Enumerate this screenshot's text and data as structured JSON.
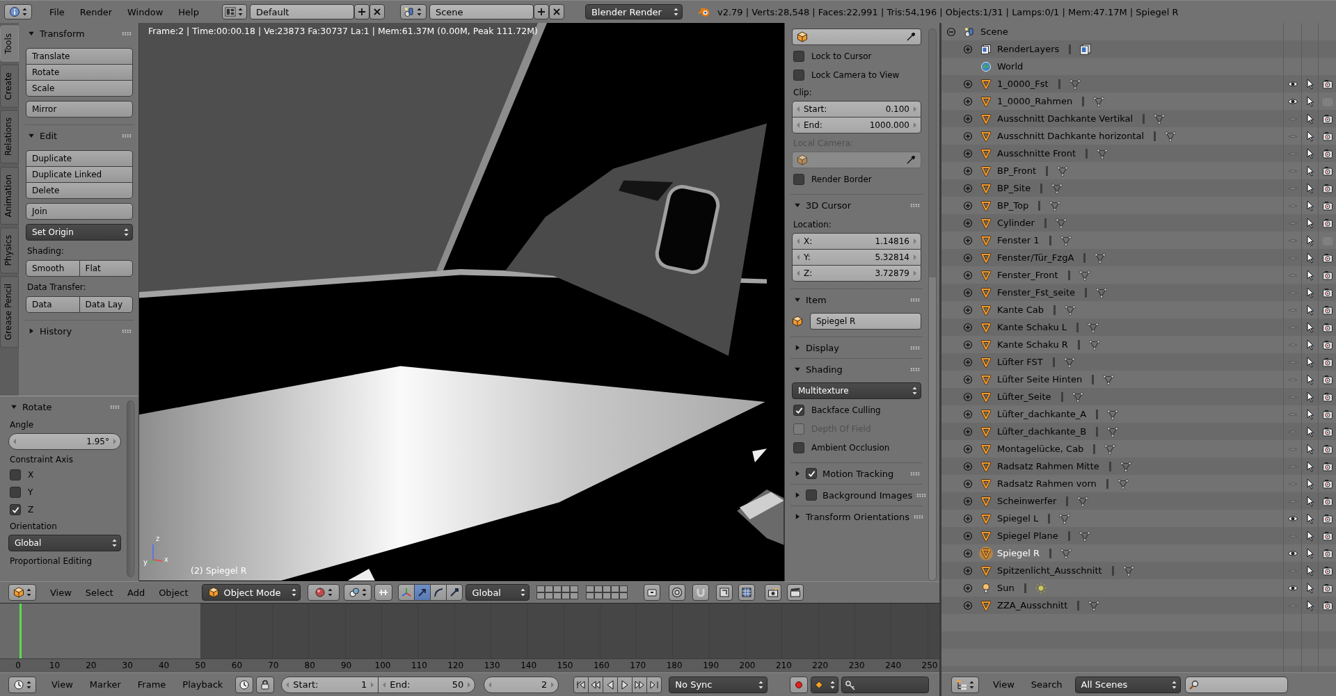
{
  "top_bar": {
    "menus": [
      "File",
      "Render",
      "Window",
      "Help"
    ],
    "screen_layout": "Default",
    "scene": "Scene",
    "render_engine": "Blender Render",
    "stats": "v2.79 | Verts:28,548 | Faces:22,991 | Tris:54,196 | Objects:1/31 | Lamps:0/1 | Mem:47.17M | Spiegel R"
  },
  "tool_shelf": {
    "tabs": [
      {
        "label": "Tools",
        "selected": true
      },
      {
        "label": "Create",
        "selected": false
      },
      {
        "label": "Relations",
        "selected": false
      },
      {
        "label": "Animation",
        "selected": false
      },
      {
        "label": "Physics",
        "selected": false
      },
      {
        "label": "Grease Pencil",
        "selected": false
      }
    ],
    "panels": [
      {
        "title": "Transform",
        "expanded": true,
        "items": [
          {
            "kind": "column",
            "buttons": [
              "Translate",
              "Rotate",
              "Scale"
            ]
          },
          {
            "kind": "column",
            "buttons": [
              "Mirror"
            ]
          }
        ]
      },
      {
        "title": "Edit",
        "expanded": true,
        "items": [
          {
            "kind": "column",
            "buttons": [
              "Duplicate",
              "Duplicate Linked",
              "Delete"
            ]
          },
          {
            "kind": "column",
            "buttons": [
              "Join"
            ]
          },
          {
            "kind": "dropdown",
            "value": "Set Origin"
          },
          {
            "kind": "label",
            "text": "Shading:"
          },
          {
            "kind": "row",
            "buttons": [
              "Smooth",
              "Flat"
            ]
          },
          {
            "kind": "label",
            "text": "Data Transfer:"
          },
          {
            "kind": "row",
            "buttons": [
              "Data",
              "Data Lay"
            ]
          }
        ]
      },
      {
        "title": "History",
        "expanded": false
      }
    ]
  },
  "operator_panel": {
    "title": "Rotate",
    "expanded": true,
    "items": [
      {
        "kind": "label",
        "text": "Angle"
      },
      {
        "kind": "number",
        "value": "1.95°"
      },
      {
        "kind": "label",
        "text": "Constraint Axis"
      },
      {
        "kind": "checkbox",
        "label": "X",
        "checked": false
      },
      {
        "kind": "checkbox",
        "label": "Y",
        "checked": false
      },
      {
        "kind": "checkbox",
        "label": "Z",
        "checked": true
      },
      {
        "kind": "label",
        "text": "Orientation"
      },
      {
        "kind": "dropdown",
        "value": "Global"
      },
      {
        "kind": "label",
        "text": "Proportional Editing"
      }
    ]
  },
  "viewport": {
    "info": "Frame:2 | Time:00:00.18 | Ve:23873 Fa:30737 La:1 | Mem:61.37M (0.00M, Peak 111.72M)",
    "object_label": "(2) Spiegel R",
    "axes": [
      "z",
      "y",
      "x"
    ]
  },
  "properties": {
    "panels": [
      {
        "items": [
          {
            "kind": "object_field",
            "disabled": false
          },
          {
            "kind": "checkbox",
            "label": "Lock to Cursor",
            "checked": false,
            "disabled": false
          },
          {
            "kind": "checkbox",
            "label": "Lock Camera to View",
            "checked": false,
            "disabled": false
          },
          {
            "kind": "label",
            "text": "Clip:",
            "disabled": false
          },
          {
            "kind": "number_group",
            "fields": [
              {
                "label": "Start:",
                "value": "0.100"
              },
              {
                "label": "End:",
                "value": "1000.000"
              }
            ]
          },
          {
            "kind": "label",
            "text": "Local Camera:",
            "disabled": true
          },
          {
            "kind": "object_field",
            "disabled": true
          },
          {
            "kind": "checkbox",
            "label": "Render Border",
            "checked": false,
            "disabled": false
          }
        ]
      },
      {
        "title": "3D Cursor",
        "expanded": true,
        "items": [
          {
            "kind": "label",
            "text": "Location:",
            "disabled": false
          },
          {
            "kind": "number_group",
            "fields": [
              {
                "label": "X:",
                "value": "1.14816"
              },
              {
                "label": "Y:",
                "value": "5.32814"
              },
              {
                "label": "Z:",
                "value": "3.72879"
              }
            ]
          }
        ]
      },
      {
        "title": "Item",
        "expanded": true,
        "items": [
          {
            "kind": "name_field",
            "value": "Spiegel R"
          }
        ]
      },
      {
        "title": "Display",
        "expanded": false
      },
      {
        "title": "Shading",
        "expanded": true,
        "items": [
          {
            "kind": "dropdown",
            "value": "Multitexture"
          },
          {
            "kind": "checkbox",
            "label": "Backface Culling",
            "checked": true,
            "disabled": false
          },
          {
            "kind": "checkbox",
            "label": "Depth Of Field",
            "checked": false,
            "disabled": true
          },
          {
            "kind": "checkbox",
            "label": "Ambient Occlusion",
            "checked": false,
            "disabled": false
          }
        ]
      },
      {
        "title": "Motion Tracking",
        "expanded": false,
        "enabled": true
      },
      {
        "title": "Background Images",
        "expanded": false,
        "enabled": false
      },
      {
        "title": "Transform Orientations",
        "expanded": false
      }
    ]
  },
  "outliner": {
    "tree": [
      {
        "name": "Scene",
        "kind": "scene",
        "expanded": true,
        "children": [
          {
            "name": "RenderLayers",
            "kind": "renderlayers",
            "expanded": false
          },
          {
            "name": "World",
            "kind": "world"
          },
          {
            "name": "1_0000_Fst",
            "kind": "mesh",
            "expanded": false,
            "visible": true,
            "renderable": true,
            "selected": false
          },
          {
            "name": "1_0000_Rahmen",
            "kind": "mesh",
            "expanded": false,
            "visible": true,
            "renderable": false,
            "selected": false
          },
          {
            "name": "Ausschnitt Dachkante Vertikal",
            "kind": "mesh",
            "expanded": false,
            "visible": false,
            "renderable": true,
            "selected": false
          },
          {
            "name": "Ausschnitt Dachkante horizontal",
            "kind": "mesh",
            "expanded": false,
            "visible": false,
            "renderable": true,
            "selected": false
          },
          {
            "name": "Ausschnitte Front",
            "kind": "mesh",
            "expanded": false,
            "visible": false,
            "renderable": true,
            "selected": false
          },
          {
            "name": "BP_Front",
            "kind": "mesh",
            "expanded": false,
            "visible": false,
            "renderable": true,
            "selected": false
          },
          {
            "name": "BP_Site",
            "kind": "mesh",
            "expanded": false,
            "visible": false,
            "renderable": true,
            "selected": false
          },
          {
            "name": "BP_Top",
            "kind": "mesh",
            "expanded": false,
            "visible": false,
            "renderable": true,
            "selected": false
          },
          {
            "name": "Cylinder",
            "kind": "mesh",
            "expanded": false,
            "visible": false,
            "renderable": true,
            "selected": false
          },
          {
            "name": "Fenster 1",
            "kind": "mesh",
            "expanded": false,
            "visible": false,
            "renderable": false,
            "selected": false
          },
          {
            "name": "Fenster/Tür_FzgA",
            "kind": "mesh",
            "expanded": false,
            "visible": false,
            "renderable": true,
            "selected": false
          },
          {
            "name": "Fenster_Front",
            "kind": "mesh",
            "expanded": false,
            "visible": false,
            "renderable": true,
            "selected": false
          },
          {
            "name": "Fenster_Fst_seite",
            "kind": "mesh",
            "expanded": false,
            "visible": false,
            "renderable": true,
            "selected": false
          },
          {
            "name": "Kante Cab",
            "kind": "mesh",
            "expanded": false,
            "visible": false,
            "renderable": true,
            "selected": false
          },
          {
            "name": "Kante Schaku L",
            "kind": "mesh",
            "expanded": false,
            "visible": false,
            "renderable": true,
            "selected": false
          },
          {
            "name": "Kante Schaku R",
            "kind": "mesh",
            "expanded": false,
            "visible": false,
            "renderable": true,
            "selected": false
          },
          {
            "name": "Lüfter FST",
            "kind": "mesh",
            "expanded": false,
            "visible": false,
            "renderable": true,
            "selected": false
          },
          {
            "name": "Lüfter Seite Hinten",
            "kind": "mesh",
            "expanded": false,
            "visible": false,
            "renderable": true,
            "selected": false
          },
          {
            "name": "Lüfter_Seite",
            "kind": "mesh",
            "expanded": false,
            "visible": false,
            "renderable": true,
            "selected": false
          },
          {
            "name": "Lüfter_dachkante_A",
            "kind": "mesh",
            "expanded": false,
            "visible": false,
            "renderable": true,
            "selected": false
          },
          {
            "name": "Lüfter_dachkante_B",
            "kind": "mesh",
            "expanded": false,
            "visible": false,
            "renderable": true,
            "selected": false
          },
          {
            "name": "Montagelücke, Cab",
            "kind": "mesh",
            "expanded": false,
            "visible": false,
            "renderable": true,
            "selected": false
          },
          {
            "name": "Radsatz Rahmen Mitte",
            "kind": "mesh",
            "expanded": false,
            "visible": false,
            "renderable": true,
            "selected": false
          },
          {
            "name": "Radsatz Rahmen vorn",
            "kind": "mesh",
            "expanded": false,
            "visible": false,
            "renderable": true,
            "selected": false
          },
          {
            "name": "Scheinwerfer",
            "kind": "mesh",
            "expanded": false,
            "visible": false,
            "renderable": true,
            "selected": false
          },
          {
            "name": "Spiegel L",
            "kind": "mesh",
            "expanded": false,
            "visible": true,
            "renderable": true,
            "selected": false
          },
          {
            "name": "Spiegel Plane",
            "kind": "mesh",
            "expanded": false,
            "visible": false,
            "renderable": true,
            "selected": false
          },
          {
            "name": "Spiegel R",
            "kind": "mesh",
            "expanded": false,
            "visible": true,
            "renderable": true,
            "selected": true
          },
          {
            "name": "Spitzenlicht_Ausschnitt",
            "kind": "mesh",
            "expanded": false,
            "visible": false,
            "renderable": true,
            "selected": false
          },
          {
            "name": "Sun",
            "kind": "lamp",
            "expanded": false,
            "visible": true,
            "renderable": true,
            "selected": false
          },
          {
            "name": "ZZA_Ausschnitt",
            "kind": "mesh",
            "expanded": false,
            "visible": false,
            "renderable": true,
            "selected": false
          }
        ]
      }
    ],
    "header": {
      "menus": [
        "View",
        "Search"
      ],
      "display_mode": "All Scenes"
    }
  },
  "view3d_header": {
    "menus": [
      "View",
      "Select",
      "Add",
      "Object"
    ],
    "mode": "Object Mode",
    "orientation": "Global",
    "manipulators": [
      {
        "selected": false
      },
      {
        "selected": true
      },
      {
        "selected": false
      },
      {
        "selected": false
      }
    ]
  },
  "timeline": {
    "ruler": [
      "0",
      "10",
      "20",
      "30",
      "40",
      "50",
      "60",
      "70",
      "80",
      "90",
      "100",
      "110",
      "120",
      "130",
      "140",
      "150",
      "160",
      "170",
      "180",
      "190",
      "200",
      "210",
      "220",
      "230",
      "240",
      "250"
    ],
    "header": {
      "menus": [
        "View",
        "Marker",
        "Frame",
        "Playback"
      ],
      "start": {
        "label": "Start:",
        "value": "1"
      },
      "end": {
        "label": "End:",
        "value": "50"
      },
      "current_frame": "2",
      "sync": "No Sync"
    }
  }
}
